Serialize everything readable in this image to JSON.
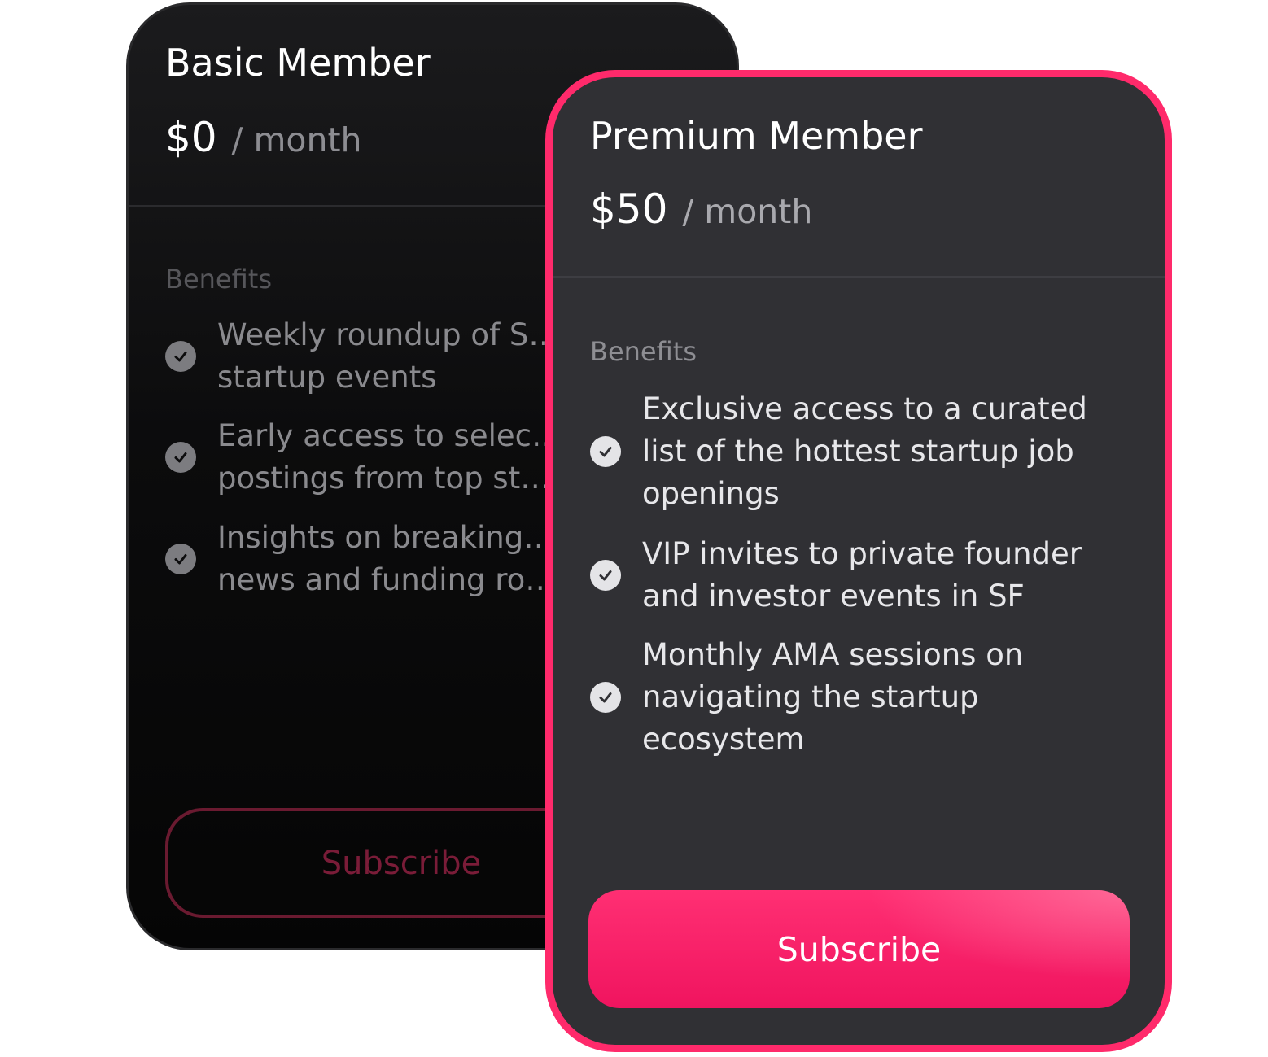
{
  "colors": {
    "accent": "#ff2a6b",
    "premium_card_bg": "#303034",
    "basic_card_bg": "#0c0c0d"
  },
  "basic": {
    "title": "Basic Member",
    "price": "$0",
    "period": "/ month",
    "benefits_heading": "Benefits",
    "benefits": [
      "Weekly roundup of S… startup events",
      "Early access to selec… postings from top st…",
      "Insights on breaking… news and funding ro…"
    ],
    "subscribe_label": "Subscribe"
  },
  "premium": {
    "title": "Premium Member",
    "price": "$50",
    "period": "/ month",
    "benefits_heading": "Benefits",
    "benefits": [
      "Exclusive access to a curated list of the hottest startup job openings",
      "VIP invites to private founder and investor events in SF",
      "Monthly AMA sessions on navigating the startup ecosystem"
    ],
    "subscribe_label": "Subscribe"
  },
  "icons": {
    "benefit_check": "check-circle-icon"
  }
}
